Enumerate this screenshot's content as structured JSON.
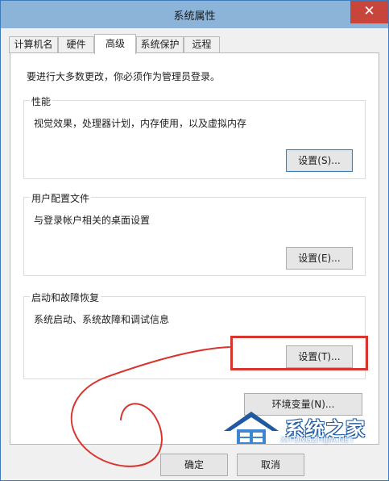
{
  "window": {
    "title": "系统属性",
    "close_glyph": "✕"
  },
  "tabs": [
    {
      "label": "计算机名",
      "active": false
    },
    {
      "label": "硬件",
      "active": false
    },
    {
      "label": "高级",
      "active": true
    },
    {
      "label": "系统保护",
      "active": false
    },
    {
      "label": "远程",
      "active": false
    }
  ],
  "notice": "要进行大多数更改，你必须作为管理员登录。",
  "performance": {
    "title": "性能",
    "desc": "视觉效果，处理器计划，内存使用，以及虚拟内存",
    "button": "设置(S)..."
  },
  "user_profiles": {
    "title": "用户配置文件",
    "desc": "与登录帐户相关的桌面设置",
    "button": "设置(E)..."
  },
  "startup_recovery": {
    "title": "启动和故障恢复",
    "desc": "系统启动、系统故障和调试信息",
    "button": "设置(T)..."
  },
  "env_button": "环境变量(N)...",
  "footer": {
    "ok": "确定",
    "cancel": "取消"
  },
  "watermark": {
    "text": "系统之家",
    "url": "XITONGZHIJIA.NET"
  },
  "colors": {
    "titlebar": "#8cb4d8",
    "close": "#c7453a",
    "annotation": "#d8352f",
    "watermark_blue": "#1f5aa0"
  }
}
